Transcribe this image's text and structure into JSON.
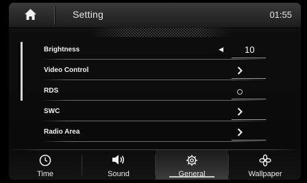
{
  "header": {
    "title": "Setting",
    "clock": "01:55",
    "home_icon": "home-icon"
  },
  "settings": {
    "brightness": {
      "label": "Brightness",
      "value": "10",
      "icon": "decrease-arrow-icon"
    },
    "video_control": {
      "label": "Video Control",
      "icon": "chevron-right-icon"
    },
    "rds": {
      "label": "RDS",
      "icon": "radio-off-icon"
    },
    "swc": {
      "label": "SWC",
      "icon": "chevron-right-icon"
    },
    "radio_area": {
      "label": "Radio Area",
      "icon": "chevron-right-icon"
    }
  },
  "tabs": [
    {
      "label": "Time",
      "icon": "clock-icon",
      "active": false
    },
    {
      "label": "Sound",
      "icon": "speaker-icon",
      "active": false
    },
    {
      "label": "General",
      "icon": "gear-icon",
      "active": true
    },
    {
      "label": "Wallpaper",
      "icon": "flower-icon",
      "active": false
    }
  ]
}
